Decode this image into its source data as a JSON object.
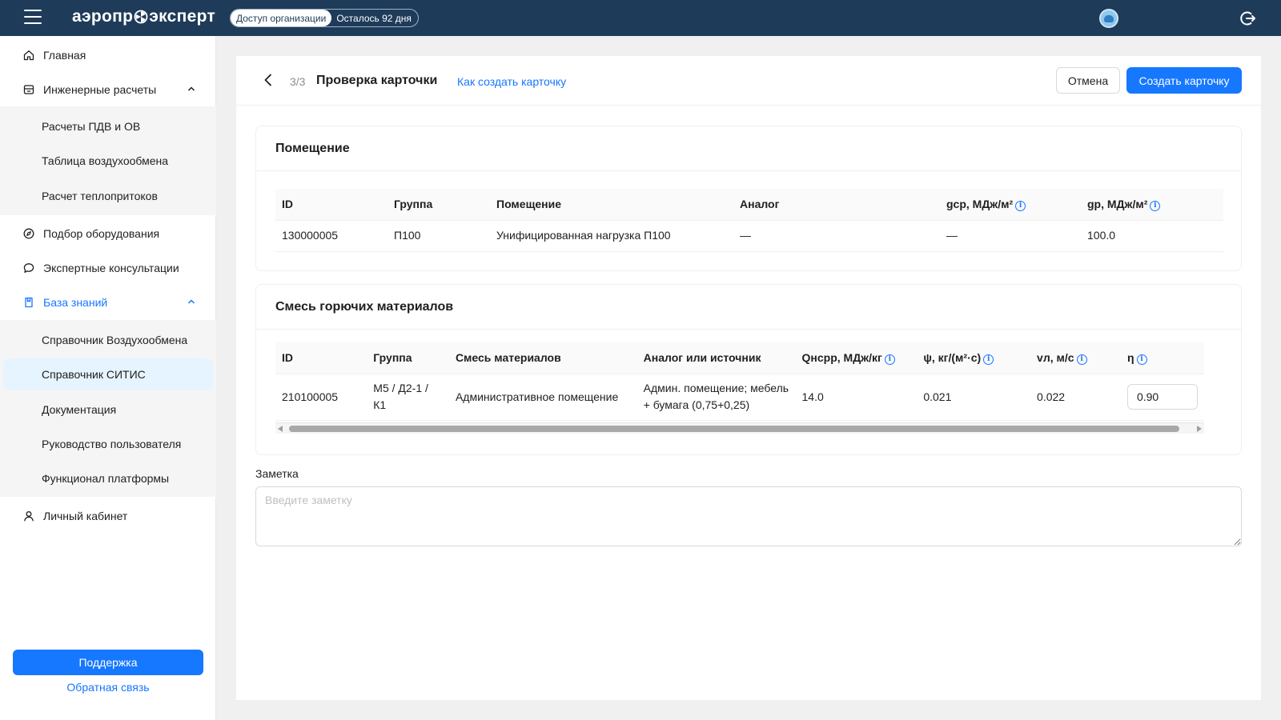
{
  "header": {
    "logo_text_left": "аэропр",
    "logo_text_right": "эксперт",
    "access_label": "Доступ организации",
    "days_left": "Осталось 92 дня"
  },
  "sidebar": {
    "home": "Главная",
    "engineering": "Инженерные расчеты",
    "engineering_items": [
      "Расчеты ПДВ и ОВ",
      "Таблица воздухообмена",
      "Расчет теплопритоков"
    ],
    "equipment": "Подбор оборудования",
    "consultations": "Экспертные консультации",
    "knowledge": "База знаний",
    "knowledge_items": [
      "Справочник Воздухообмена",
      "Справочник СИТИС",
      "Документация",
      "Руководство пользователя",
      "Функционал платформы"
    ],
    "account": "Личный кабинет",
    "support": "Поддержка",
    "feedback": "Обратная связь"
  },
  "page": {
    "step": "3/3",
    "title": "Проверка карточки",
    "howto_link": "Как создать карточку",
    "cancel": "Отмена",
    "create": "Создать карточку"
  },
  "room_panel": {
    "title": "Помещение",
    "columns": [
      "ID",
      "Группа",
      "Помещение",
      "Аналог",
      "gср, МДж/м²",
      "gр, МДж/м²"
    ],
    "row": [
      "130000005",
      "П100",
      "Унифицированная нагрузка П100",
      "—",
      "—",
      "100.0"
    ]
  },
  "mix_panel": {
    "title": "Смесь горючих материалов",
    "columns": [
      "ID",
      "Группа",
      "Смесь материалов",
      "Аналог или источник",
      "Qнсрр, МДж/кг",
      "ψ, кг/(м²·с)",
      "vл, м/с",
      "η"
    ],
    "row": [
      "210100005",
      "М5 / Д2-1 / К1",
      "Административное помещение",
      "Админ. помещение; мебель + бумага (0,75+0,25)",
      "14.0",
      "0.021",
      "0.022"
    ],
    "eta_value": "0.90"
  },
  "note": {
    "label": "Заметка",
    "placeholder": "Введите заметку"
  },
  "colors": {
    "header_bg": "#1e3c5a",
    "accent": "#1677ff",
    "selected_bg": "#e6f4ff"
  }
}
